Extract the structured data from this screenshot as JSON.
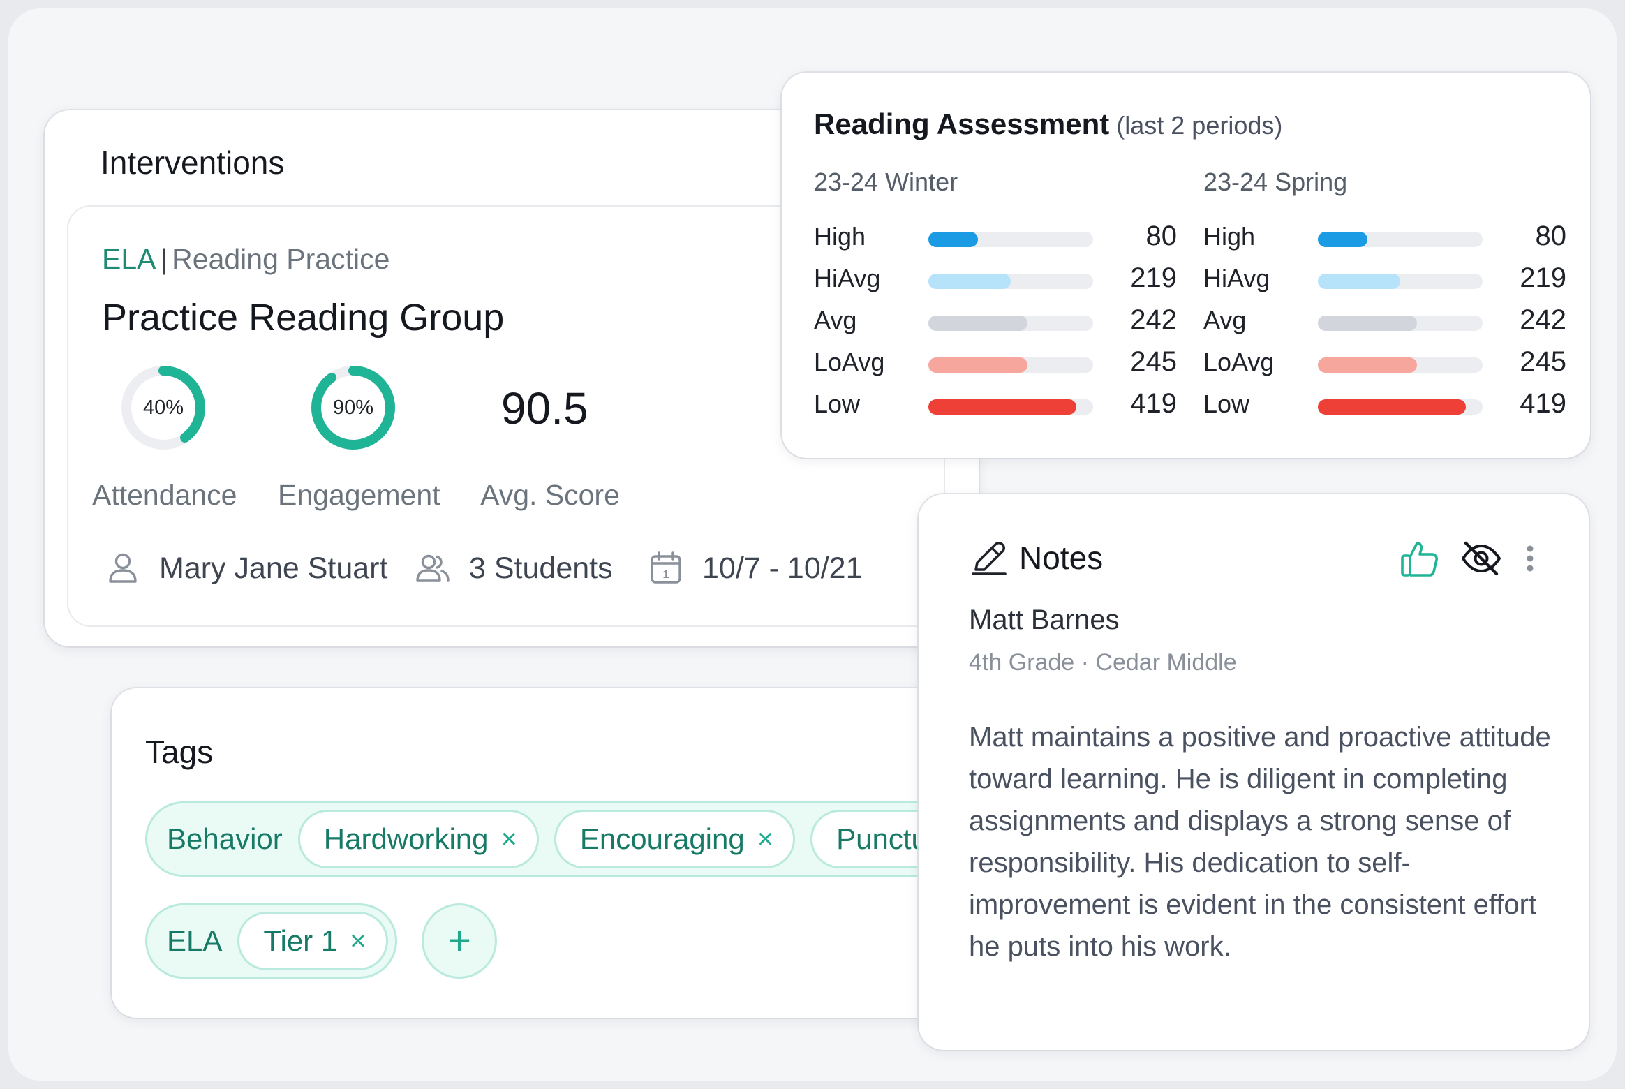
{
  "interventions": {
    "title": "Interventions",
    "card": {
      "subject": "ELA",
      "separator": "|",
      "category": "Reading Practice",
      "group_name": "Practice Reading Group",
      "attendance": {
        "label": "Attendance",
        "value_text": "40%",
        "fraction": 0.4
      },
      "engagement": {
        "label": "Engagement",
        "value_text": "90%",
        "fraction": 0.9
      },
      "avg_score": {
        "label": "Avg. Score",
        "value": "90.5"
      },
      "teacher": "Mary Jane Stuart",
      "students": "3 Students",
      "date_range": "10/7 - 10/21",
      "accent": "#1fb496"
    }
  },
  "tags": {
    "title": "Tags",
    "groups": [
      {
        "label": "Behavior",
        "chips": [
          "Hardworking",
          "Encouraging",
          "Punctu"
        ]
      },
      {
        "label": "ELA",
        "chips": [
          "Tier 1"
        ]
      }
    ],
    "remove_glyph": "×",
    "add_glyph": "+"
  },
  "assessment": {
    "title": "Reading Assessment",
    "subtitle": "(last 2 periods)",
    "periods": [
      {
        "name": "23-24 Winter",
        "bands": [
          {
            "label": "High",
            "value": "80",
            "fraction": 0.3,
            "color": "#1a9be3"
          },
          {
            "label": "HiAvg",
            "value": "219",
            "fraction": 0.5,
            "color": "#b6e3fa"
          },
          {
            "label": "Avg",
            "value": "242",
            "fraction": 0.6,
            "color": "#d2d6dc"
          },
          {
            "label": "LoAvg",
            "value": "245",
            "fraction": 0.6,
            "color": "#f7a69d"
          },
          {
            "label": "Low",
            "value": "419",
            "fraction": 0.9,
            "color": "#ee4036"
          }
        ]
      },
      {
        "name": "23-24 Spring",
        "bands": [
          {
            "label": "High",
            "value": "80",
            "fraction": 0.3,
            "color": "#1a9be3"
          },
          {
            "label": "HiAvg",
            "value": "219",
            "fraction": 0.5,
            "color": "#b6e3fa"
          },
          {
            "label": "Avg",
            "value": "242",
            "fraction": 0.6,
            "color": "#d2d6dc"
          },
          {
            "label": "LoAvg",
            "value": "245",
            "fraction": 0.6,
            "color": "#f7a69d"
          },
          {
            "label": "Low",
            "value": "419",
            "fraction": 0.9,
            "color": "#ee4036"
          }
        ]
      }
    ]
  },
  "notes": {
    "title": "Notes",
    "student_name": "Matt Barnes",
    "student_meta": "4th Grade · Cedar Middle",
    "text": "Matt maintains a positive and proactive attitude toward learning. He is diligent in completing assignments and displays a strong sense of responsibility. His dedication to self-improvement is evident in the consistent effort he puts into his work.",
    "icons": [
      "pencil-icon",
      "thumbs-up-icon",
      "eye-off-icon",
      "more-vertical-icon"
    ]
  }
}
